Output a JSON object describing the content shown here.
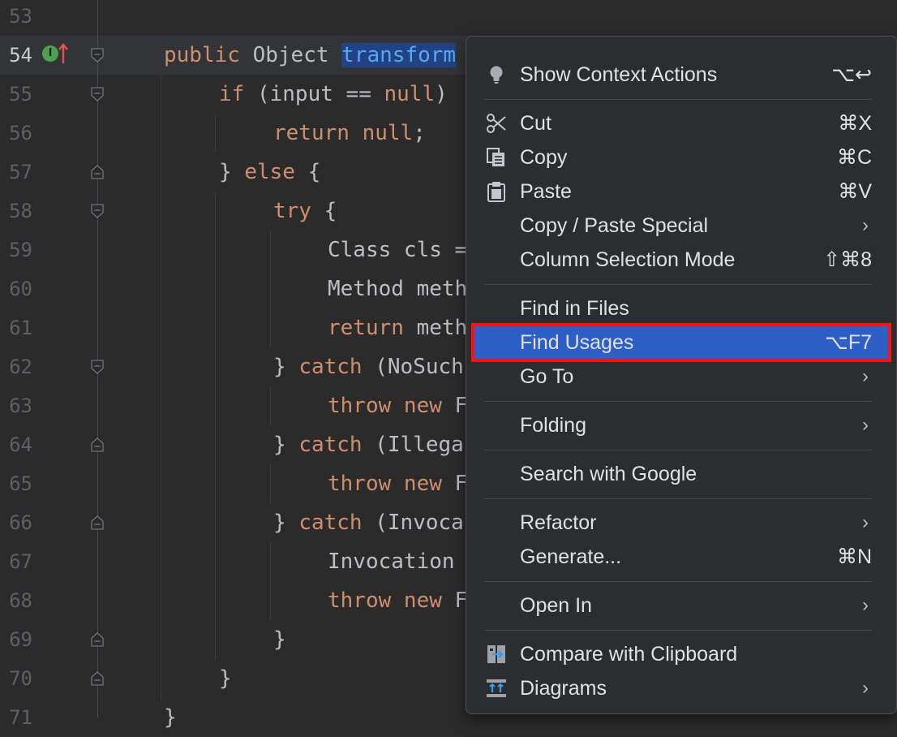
{
  "editor": {
    "lines": [
      {
        "num": "53",
        "code": []
      },
      {
        "num": "54",
        "code": [
          {
            "t": "public Object ",
            "c": "kw-mix"
          }
        ]
      },
      {
        "num": "55"
      },
      {
        "num": "56"
      },
      {
        "num": "57"
      },
      {
        "num": "58"
      },
      {
        "num": "59"
      },
      {
        "num": "60"
      },
      {
        "num": "61"
      },
      {
        "num": "62"
      },
      {
        "num": "63"
      },
      {
        "num": "64"
      },
      {
        "num": "65"
      },
      {
        "num": "66"
      },
      {
        "num": "67"
      },
      {
        "num": "68"
      },
      {
        "num": "69"
      },
      {
        "num": "70"
      },
      {
        "num": "71"
      }
    ],
    "code": {
      "l54_kw": "public",
      "l54_type": " Object ",
      "l54_method": "transform",
      "l55_kw": "if",
      "l55_rest": " (input == ",
      "l55_null": "null",
      "l55_close": ")",
      "l56_kw": "return",
      "l56_null": " null",
      "l56_semi": ";",
      "l57_brace": "} ",
      "l57_kw": "else",
      "l57_rest": " {",
      "l58_kw": "try",
      "l58_rest": " {",
      "l59": "Class cls =",
      "l60": "Method meth",
      "l61_kw": "return",
      "l61_rest": " meth",
      "l62_brace": "} ",
      "l62_kw": "catch",
      "l62_rest": " (NoSuch",
      "l63_kw": "throw new",
      "l63_rest": " F",
      "l64_brace": "} ",
      "l64_kw": "catch",
      "l64_rest": " (Illega",
      "l65_kw": "throw new",
      "l65_rest": " F",
      "l66_brace": "} ",
      "l66_kw": "catch",
      "l66_rest": " (Invoca",
      "l67": "Invocation",
      "l68_kw": "throw new",
      "l68_rest": " F",
      "l69": "}",
      "l70": "}",
      "l71": "}"
    },
    "badge_letter": "I"
  },
  "menu": {
    "items": [
      {
        "label": "Show Context Actions",
        "shortcut": "⌥↩",
        "icon": "lightbulb-icon"
      },
      {
        "label": "Cut",
        "shortcut": "⌘X",
        "icon": "scissors-icon"
      },
      {
        "label": "Copy",
        "shortcut": "⌘C",
        "icon": "copy-icon"
      },
      {
        "label": "Paste",
        "shortcut": "⌘V",
        "icon": "clipboard-icon"
      },
      {
        "label": "Copy / Paste Special",
        "submenu": true
      },
      {
        "label": "Column Selection Mode",
        "shortcut": "⇧⌘8"
      },
      {
        "label": "Find in Files"
      },
      {
        "label": "Find Usages",
        "shortcut": "⌥F7",
        "selected": true
      },
      {
        "label": "Go To",
        "submenu": true
      },
      {
        "label": "Folding",
        "submenu": true
      },
      {
        "label": "Search with Google"
      },
      {
        "label": "Refactor",
        "submenu": true
      },
      {
        "label": "Generate...",
        "shortcut": "⌘N"
      },
      {
        "label": "Open In",
        "submenu": true
      },
      {
        "label": "Compare with Clipboard",
        "icon": "compare-icon"
      },
      {
        "label": "Diagrams",
        "submenu": true,
        "icon": "diagram-icon"
      }
    ],
    "chevron": "›"
  },
  "colors": {
    "background": "#2b2b2c",
    "keyword": "#cf8e6d",
    "selection_highlight": "#2d5fc6",
    "focus_outline": "#ff1010"
  }
}
